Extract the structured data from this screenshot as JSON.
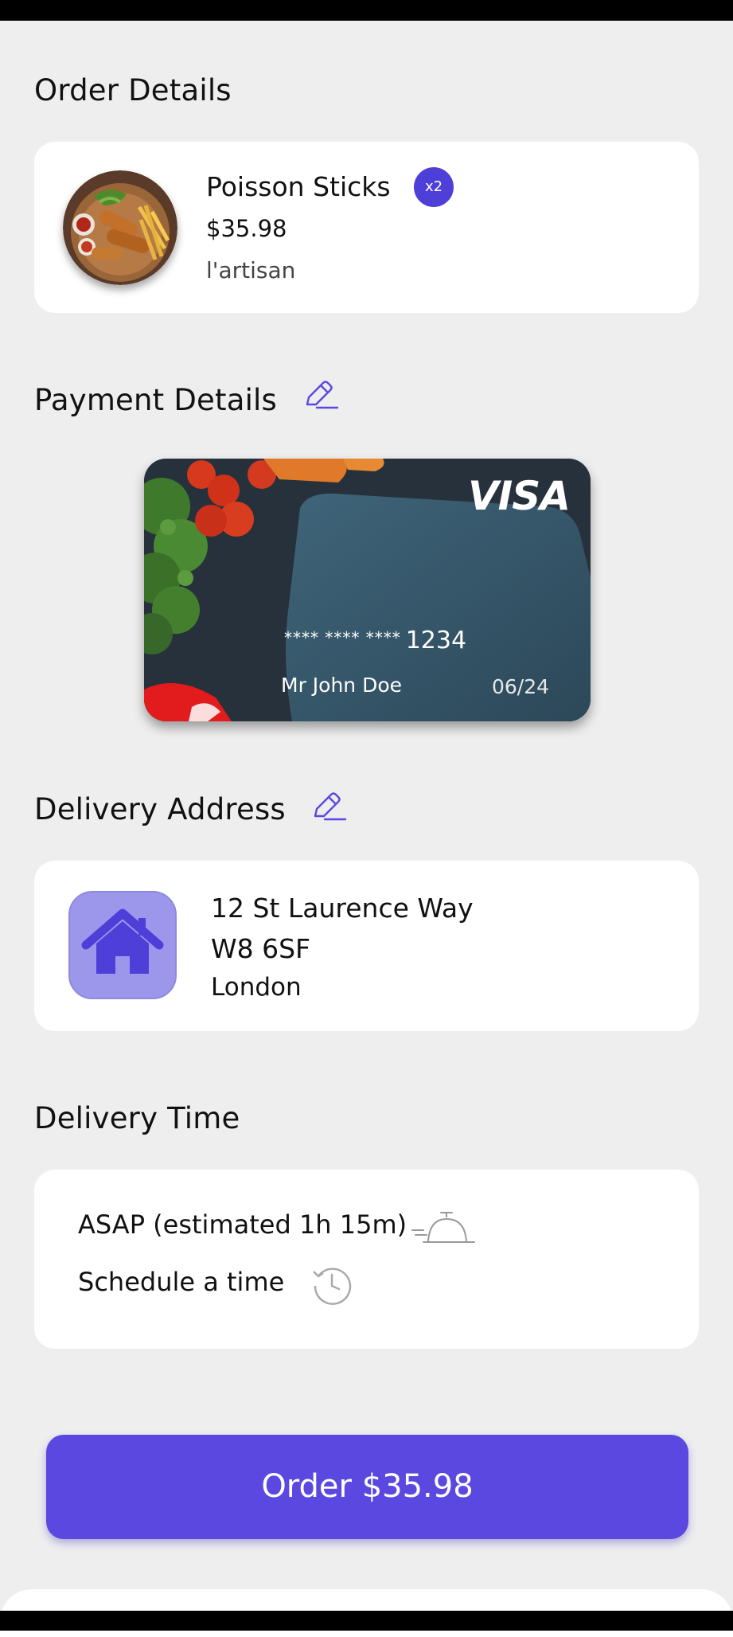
{
  "order": {
    "title": "Order Details",
    "item": {
      "name": "Poisson Sticks",
      "quantity": "x2",
      "price": "$35.98",
      "restaurant": "l'artisan"
    }
  },
  "payment": {
    "title": "Payment Details",
    "edit_icon": "pencil-icon",
    "card": {
      "brand": "VISA",
      "number_mask": "**** **** ****",
      "last4": "1234",
      "holder": "Mr John Doe",
      "expiry": "06/24"
    }
  },
  "address": {
    "title": "Delivery Address",
    "edit_icon": "pencil-icon",
    "icon": "home-icon",
    "line1": "12 St Laurence Way",
    "line2": "W8 6SF",
    "city": "London"
  },
  "delivery_time": {
    "title": "Delivery Time",
    "options": [
      {
        "label": "ASAP (estimated 1h 15m)",
        "icon": "cloche-icon"
      },
      {
        "label": "Schedule a time",
        "icon": "history-clock-icon"
      }
    ]
  },
  "order_button": {
    "label": "Order $35.98"
  },
  "colors": {
    "accent": "#5a48e0",
    "badge": "#4f3fd9",
    "home_tile": "#9d97ec",
    "background": "#eeeeef"
  }
}
